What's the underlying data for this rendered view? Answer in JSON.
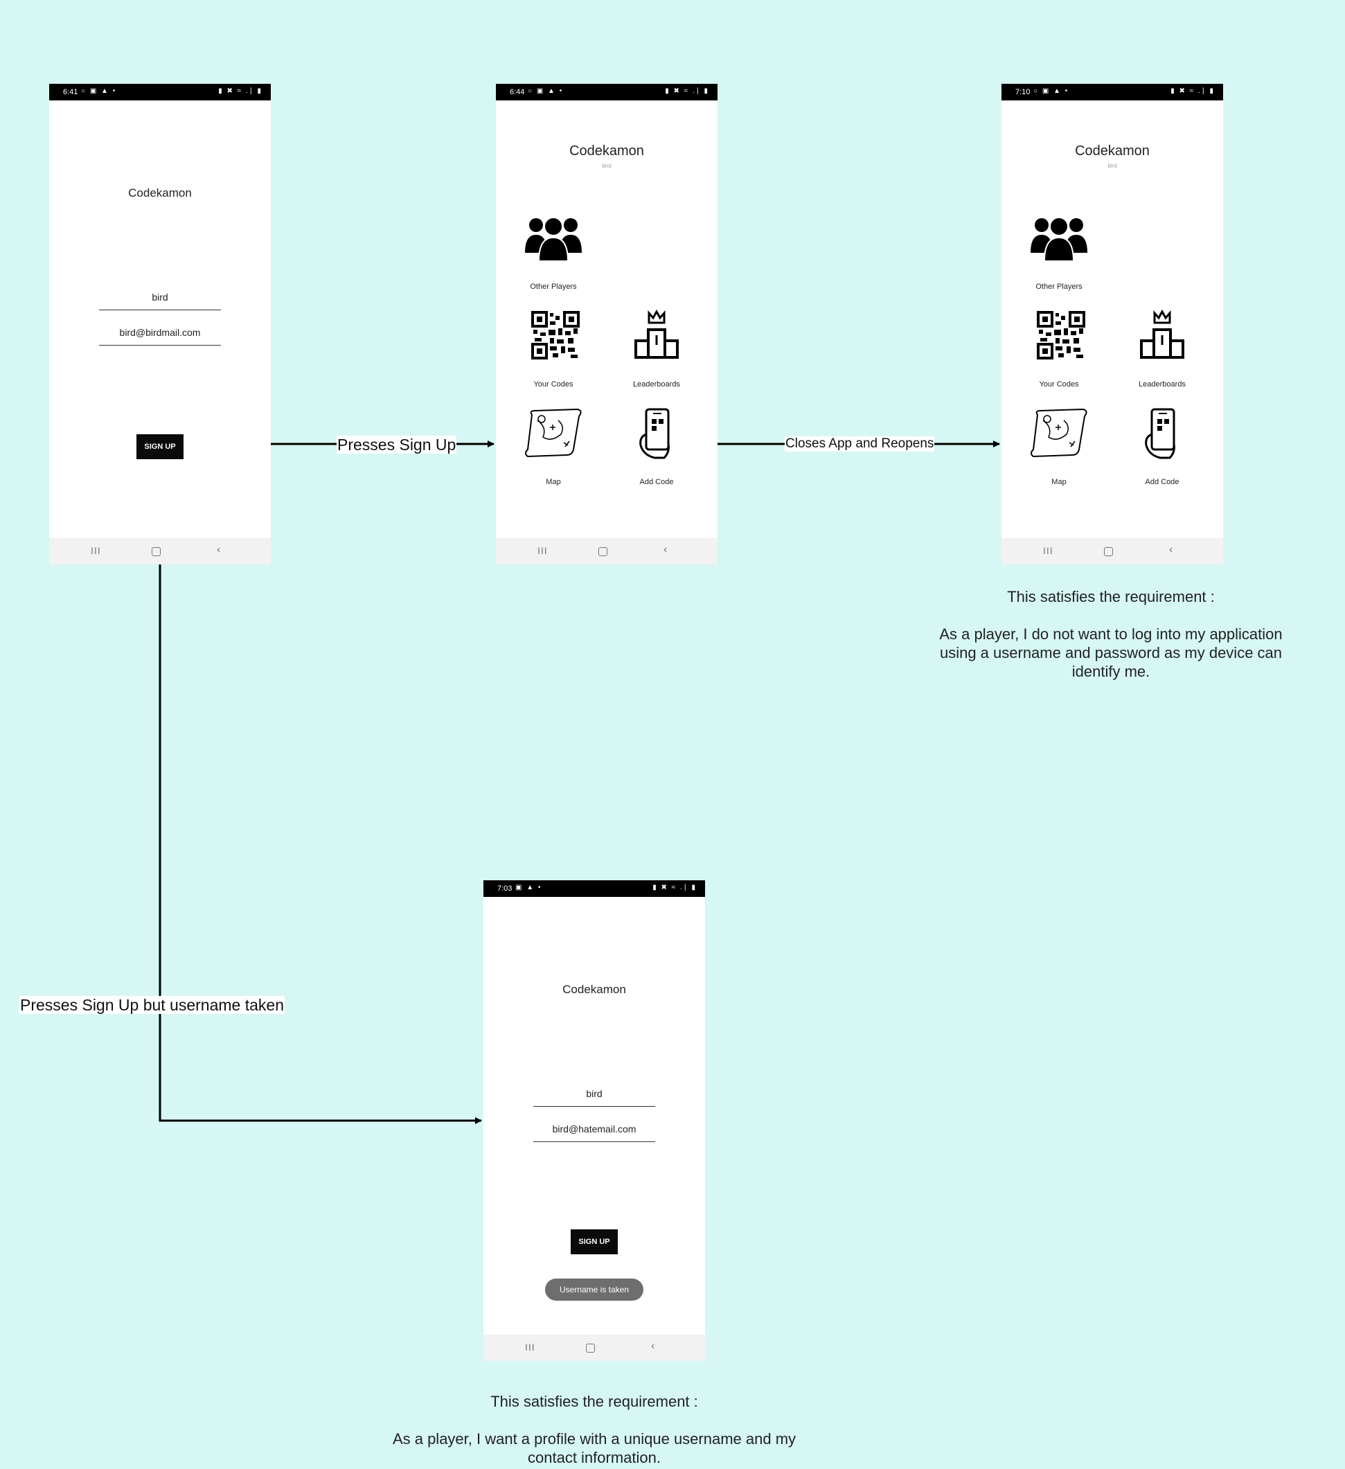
{
  "app_name": "Codekamon",
  "screens": {
    "signup1": {
      "time": "6:41",
      "status_left": "○ ▣ ▲ •",
      "status_right": "▮ ✖ ≈ .∣ ▮",
      "title": "Codekamon",
      "username_value": "bird",
      "email_value": "bird@birdmail.com",
      "button_label": "SIGN UP"
    },
    "home1": {
      "time": "6:44",
      "status_left": "○ ▣ ▲ •",
      "status_right": "▮ ✖ ≈ .∣ ▮",
      "title": "Codekamon",
      "subtitle": "bird",
      "tiles": [
        "Other Players",
        "Your Codes",
        "Leaderboards",
        "Map",
        "Add Code"
      ]
    },
    "home2": {
      "time": "7:10",
      "status_left": "○ ▣ ▲ •",
      "status_right": "▮ ✖ ≈ .∣ ▮",
      "title": "Codekamon",
      "subtitle": "bird",
      "tiles": [
        "Other Players",
        "Your Codes",
        "Leaderboards",
        "Map",
        "Add Code"
      ]
    },
    "signup2": {
      "time": "7:03",
      "status_left": "▣ ▲ •",
      "status_right": "▮ ✖ ≈ .∣ ▮",
      "title": "Codekamon",
      "username_value": "bird",
      "email_value": "bird@hatemail.com",
      "button_label": "SIGN UP",
      "toast": "Username is taken"
    }
  },
  "nav": {
    "recents": "III",
    "back": "‹"
  },
  "transitions": {
    "signup_to_home": "Presses Sign Up",
    "home_to_home": "Closes App and Reopens",
    "signup_taken": "Presses Sign Up  but username taken"
  },
  "notes": {
    "req1_heading": "This satisfies the requirement :",
    "req1_body": "As a player, I do not want to log into my application using a username and password as my device can identify me.",
    "req2_heading": "This satisfies the requirement :",
    "req2_body": "As a player, I want a profile with a unique username and my contact information."
  }
}
